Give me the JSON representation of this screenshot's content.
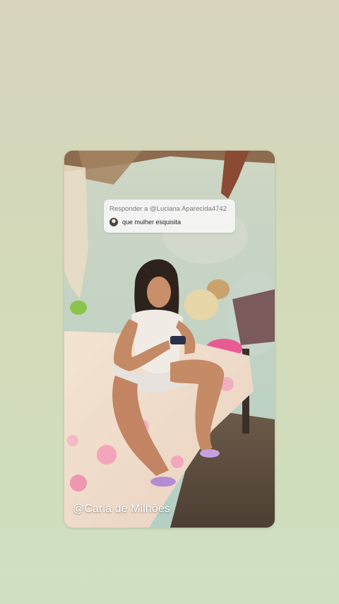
{
  "story": {
    "reply_sticker": {
      "header": "Responder a @Luciana Aparecida4742",
      "comment": "que mulher esquisita",
      "avatar_icon": "user-avatar-icon"
    },
    "watermark": "@Carla de Milhões"
  },
  "colors": {
    "page_background_top": "#d7d3bd",
    "page_background_bottom": "#cfe0c0",
    "sticker_background": "#f4f4f4"
  }
}
